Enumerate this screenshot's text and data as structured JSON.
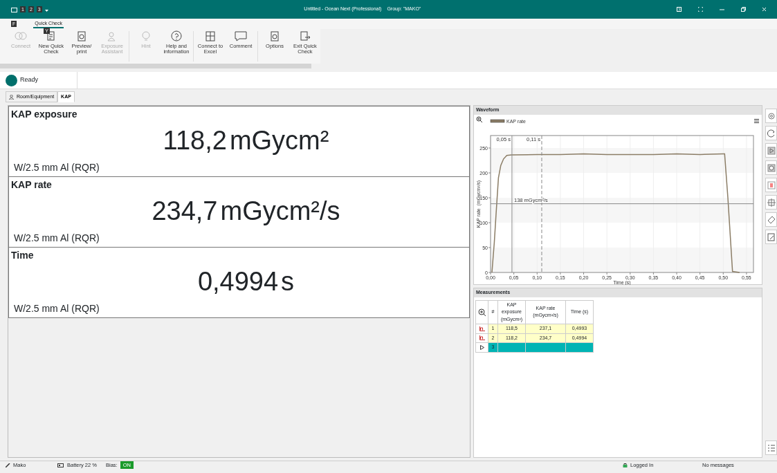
{
  "window": {
    "title": "Untitled - Ocean Next (Professional)",
    "group": "Group: \"MAKO\""
  },
  "quick_access": {
    "key_tips": [
      "1",
      "2",
      "3"
    ]
  },
  "ribbon": {
    "file_key_tip": "F",
    "tabs": [
      {
        "label": "Quick Check",
        "selected": true,
        "key_tip": "Y"
      }
    ],
    "groups": [
      {
        "buttons": [
          {
            "label": "Connect",
            "disabled": true
          },
          {
            "label": "New Quick Check",
            "disabled": false
          },
          {
            "label": "Preview/ print",
            "disabled": false
          },
          {
            "label": "Exposure Assistant",
            "disabled": true
          }
        ]
      },
      {
        "buttons": [
          {
            "label": "Hint",
            "disabled": true
          },
          {
            "label": "Help and information",
            "disabled": false
          }
        ]
      },
      {
        "buttons": [
          {
            "label": "Connect to Excel",
            "disabled": false
          },
          {
            "label": "Comment",
            "disabled": false
          }
        ]
      },
      {
        "buttons": [
          {
            "label": "Options",
            "disabled": false
          },
          {
            "label": "Exit Quick Check",
            "disabled": false
          }
        ]
      }
    ]
  },
  "status": {
    "text": "Ready",
    "color": "#006f6b"
  },
  "tabs": [
    {
      "label": "Room/Equipment",
      "selected": false
    },
    {
      "label": "KAP",
      "selected": true
    }
  ],
  "readings": [
    {
      "title": "KAP exposure",
      "value": "118,2",
      "unit": "mGycm²",
      "filter": "W/2.5 mm Al (RQR)"
    },
    {
      "title": "KAP rate",
      "value": "234,7",
      "unit": "mGycm²/s",
      "filter": "W/2.5 mm Al (RQR)"
    },
    {
      "title": "Time",
      "value": "0,4994",
      "unit": "s",
      "filter": "W/2.5 mm Al (RQR)"
    }
  ],
  "waveform": {
    "title": "Waveform",
    "chart_data": {
      "type": "line",
      "xlabel": "Time (s)",
      "ylabel": "KAP rate  (mGycm²/s)",
      "xlim": [
        0,
        0.565
      ],
      "ylim": [
        0,
        275
      ],
      "x": [
        0.003,
        0.008,
        0.012,
        0.017,
        0.022,
        0.028,
        0.035,
        0.045,
        0.1,
        0.15,
        0.2,
        0.25,
        0.3,
        0.35,
        0.4,
        0.45,
        0.5,
        0.503,
        0.51,
        0.52,
        0.535
      ],
      "series": [
        {
          "name": "KAP rate",
          "color": "#8b7d66",
          "values": [
            0,
            60,
            120,
            190,
            215,
            228,
            235,
            236,
            237,
            237,
            238,
            237,
            237,
            237,
            238,
            237,
            238,
            238,
            150,
            2,
            0
          ]
        }
      ],
      "xticks": [
        {
          "value": 0,
          "label": "0,00"
        },
        {
          "value": 0.05,
          "label": "0,05"
        },
        {
          "value": 0.1,
          "label": "0,10"
        },
        {
          "value": 0.15,
          "label": "0,15"
        },
        {
          "value": 0.2,
          "label": "0,20"
        },
        {
          "value": 0.25,
          "label": "0,25"
        },
        {
          "value": 0.3,
          "label": "0,30"
        },
        {
          "value": 0.35,
          "label": "0,35"
        },
        {
          "value": 0.4,
          "label": "0,40"
        },
        {
          "value": 0.45,
          "label": "0,45"
        },
        {
          "value": 0.5,
          "label": "0,50"
        },
        {
          "value": 0.55,
          "label": "0,55"
        }
      ],
      "yticks": [
        0,
        50,
        100,
        150,
        200,
        250
      ],
      "grid": true,
      "ref_lines": [
        {
          "axis": "x",
          "value": 0.046,
          "label": "0,05 s"
        },
        {
          "axis": "x",
          "value": 0.11,
          "label": "0,11 s"
        },
        {
          "axis": "y",
          "value": 138,
          "label": "138 mGycm²/s"
        }
      ]
    }
  },
  "measurements": {
    "title": "Measurements",
    "columns": [
      "#",
      "KAP exposure (mGycm²)",
      "KAP rate (mGycm²/s)",
      "Time (s)"
    ],
    "rows": [
      {
        "kind": "measurement",
        "cells": [
          "1",
          "118,5",
          "237,1",
          "0,4993"
        ]
      },
      {
        "kind": "measurement",
        "cells": [
          "2",
          "118,2",
          "234,7",
          "0,4994"
        ]
      },
      {
        "kind": "new",
        "cells": [
          "3",
          "",
          "",
          ""
        ]
      }
    ]
  },
  "status_bar": {
    "device": "Mako",
    "battery": "Battery 22 %",
    "bias_label": "Bias:",
    "bias": "ON",
    "bias_on": true,
    "login": "Logged In",
    "messages": "No messages"
  }
}
